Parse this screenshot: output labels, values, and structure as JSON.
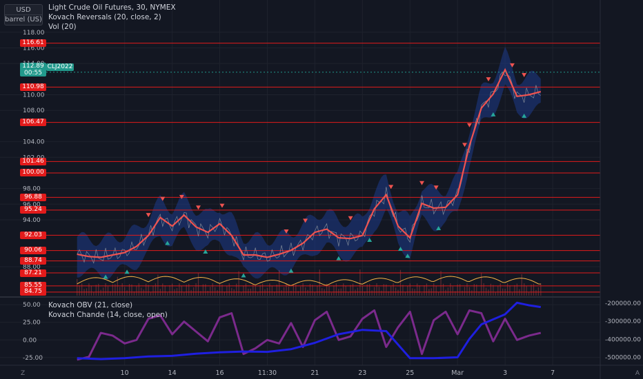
{
  "header": {
    "currency_button": "USD",
    "unit_button": "barrel (US)",
    "title": "Light Crude Oil Futures, 30, NYMEX",
    "indicator_1": "Kovach Reversals (20, close, 2)",
    "indicator_2": "Vol (20)",
    "lower_indicator_1": "Kovach OBV (21, close)",
    "lower_indicator_2": "Kovach Chande (14, close, open)"
  },
  "current_price": {
    "value": "112.89",
    "countdown": "00:55",
    "symbol": "CLJ2022"
  },
  "colors": {
    "background": "#131722",
    "level_line": "#e31b1b",
    "price_line": "#ef5350",
    "band_fill": "#1e3a8a",
    "arrow_up": "#26a69a",
    "arrow_down": "#ef5350",
    "obv": "#1f1fe0",
    "chande": "#7b2a8c",
    "volume_osc": "#f5b347"
  },
  "chart_data": [
    {
      "type": "line",
      "title": "Light Crude Oil Futures, 30, NYMEX",
      "ylabel": "",
      "ylim": [
        84.3,
        118.6
      ],
      "y_ticks": [
        "88.00",
        "94.00",
        "96.00",
        "98.00",
        "102.00",
        "104.00",
        "108.00",
        "110.00",
        "114.00",
        "116.00",
        "118.00"
      ],
      "x_ticks": [
        "10",
        "14",
        "16",
        "11:30",
        "21",
        "23",
        "25",
        "Mar",
        "3",
        "7"
      ],
      "x_tick_pos": [
        2,
        4,
        6,
        8,
        10,
        12,
        14,
        16,
        18,
        20
      ],
      "xlim": [
        -1.5,
        22
      ],
      "levels": [
        "116.61",
        "110.98",
        "106.47",
        "101.46",
        "100.00",
        "96.88",
        "95.24",
        "92.03",
        "90.06",
        "88.74",
        "87.21",
        "85.55",
        "84.75"
      ],
      "series": [
        {
          "x": [
            0,
            0.5,
            1,
            1.5,
            2,
            2.5,
            3,
            3.5,
            4,
            4.5,
            5,
            5.5,
            6,
            6.5,
            7,
            7.5,
            8,
            8.5,
            9,
            9.5,
            10,
            10.5,
            11,
            11.5,
            12,
            12.5,
            13,
            13.5,
            14,
            14.5,
            15,
            15.5,
            16,
            16.5,
            17,
            17.5,
            18,
            18.5,
            19,
            19.5
          ],
          "values": [
            89.6,
            89.3,
            89.2,
            89.5,
            89.8,
            90.6,
            92.0,
            94.3,
            93.2,
            94.6,
            93.1,
            92.4,
            93.5,
            92.0,
            89.5,
            89.5,
            89.2,
            89.6,
            90.1,
            91.0,
            92.4,
            92.8,
            91.7,
            91.6,
            92.0,
            95.4,
            97.2,
            93.2,
            91.7,
            96.1,
            95.5,
            95.6,
            97.2,
            103.5,
            108.3,
            110.1,
            113.2,
            109.8,
            110.0,
            110.4
          ]
        }
      ],
      "arrows_down_x": [
        3.0,
        3.6,
        4.4,
        5.1,
        6.1,
        8.8,
        9.6,
        11.5,
        13.2,
        14.5,
        15.1,
        16.3,
        16.5,
        17.3,
        18.3,
        18.8
      ],
      "arrows_up_x": [
        1.2,
        2.1,
        3.8,
        5.4,
        7.0,
        9.0,
        11.0,
        12.3,
        13.6,
        13.9,
        15.2,
        17.5,
        18.8
      ]
    },
    {
      "type": "line",
      "title": "Kovach OBV (21, close) / Kovach Chande (14, close, open)",
      "left_ylim": [
        -35,
        60
      ],
      "left_ticks": [
        "50.00",
        "25.00",
        "0.00",
        "-25.00"
      ],
      "right_ylim": [
        -540000,
        -170000
      ],
      "right_ticks": [
        "-200000.00",
        "-300000.00",
        "-400000.00",
        "-500000.00"
      ],
      "series": [
        {
          "name": "Kovach OBV (21, close)",
          "axis": "right",
          "x": [
            0,
            1,
            2,
            3,
            4,
            5,
            6,
            7,
            8,
            9,
            10,
            11,
            12,
            13,
            14,
            15,
            16,
            16.5,
            17,
            18,
            18.5,
            19,
            19.5
          ],
          "values": [
            -505000,
            -510000,
            -505000,
            -495000,
            -492000,
            -480000,
            -472000,
            -468000,
            -470000,
            -455000,
            -420000,
            -372000,
            -348000,
            -355000,
            -505000,
            -505000,
            -500000,
            -398000,
            -318000,
            -262000,
            -198000,
            -212000,
            -222000
          ]
        },
        {
          "name": "Kovach Chande (14, close, open)",
          "axis": "left",
          "x": [
            0,
            0.5,
            1,
            1.5,
            2,
            2.5,
            3,
            3.5,
            4,
            4.5,
            5,
            5.5,
            6,
            6.5,
            7,
            7.5,
            8,
            8.5,
            9,
            9.5,
            10,
            10.5,
            11,
            11.5,
            12,
            12.5,
            13,
            13.5,
            14,
            14.5,
            15,
            15.5,
            16,
            16.5,
            17,
            17.5,
            18,
            18.5,
            19,
            19.5
          ],
          "values": [
            -28,
            -24,
            10,
            6,
            -5,
            0,
            30,
            35,
            8,
            26,
            12,
            -2,
            32,
            38,
            -20,
            -12,
            0,
            -5,
            24,
            -10,
            28,
            40,
            0,
            5,
            30,
            42,
            -10,
            18,
            40,
            -20,
            28,
            40,
            8,
            42,
            38,
            -2,
            30,
            0,
            6,
            10
          ]
        }
      ]
    }
  ]
}
